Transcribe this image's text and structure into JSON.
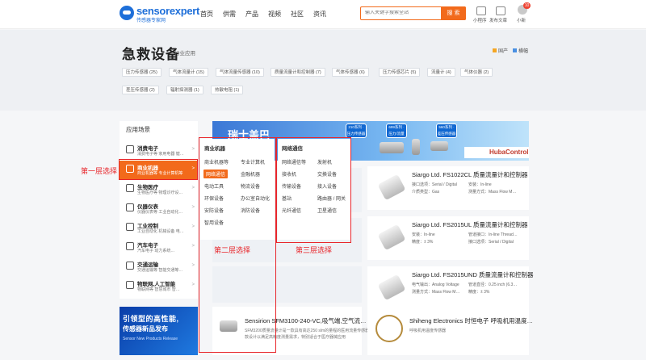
{
  "header": {
    "logo_text": "sensorexpert",
    "logo_sub": "传感器专家网",
    "nav": [
      "首页",
      "供需",
      "产品",
      "视频",
      "社区",
      "资讯"
    ],
    "search_placeholder": "输入关键字搜索全站",
    "search_button": "搜 索",
    "icons": [
      {
        "label": "小程序",
        "icon": "mini-program-icon"
      },
      {
        "label": "发布文章",
        "icon": "publish-icon"
      },
      {
        "label": "小新",
        "icon": "user-avatar-icon"
      }
    ],
    "badge": "10"
  },
  "title": {
    "main": "急救设备",
    "sub": "行业应用",
    "legend": [
      {
        "label": "国产",
        "color": "#f5a623"
      },
      {
        "label": "横幅",
        "color": "#4a90e2"
      }
    ]
  },
  "tags_row1": [
    "压力传感器 (25)",
    "气体流量计 (15)",
    "气体流量传感器 (10)",
    "质量流量计和控制器 (7)",
    "气体传感器 (6)",
    "压力传感芯片 (5)",
    "流量计 (4)",
    "气体仪器 (2)"
  ],
  "tags_row2": [
    "差压传感器 (2)",
    "辐射探测器 (1)",
    "热敏电阻 (1)"
  ],
  "sidebar": {
    "heading": "应用场景",
    "items": [
      {
        "title": "消费电子",
        "sub": "消费电子等  家用电器  健…"
      },
      {
        "title": "商业机器",
        "sub": "商业机器等  专业计算机等"
      },
      {
        "title": "生物医疗",
        "sub": "生物医疗等  物理诊疗设…"
      },
      {
        "title": "仪器仪表",
        "sub": "仪器仪表等  工业自动化…"
      },
      {
        "title": "工业控制",
        "sub": "工业自动化  机械设备  电…"
      },
      {
        "title": "汽车电子",
        "sub": "汽车电子   动力系统…"
      },
      {
        "title": "交通运输",
        "sub": "交通运输等  智能交通等…"
      },
      {
        "title": "物联网,人工智能",
        "sub": "物联网等  智慧城市  智…"
      }
    ]
  },
  "menu2": {
    "heading": "商业机器",
    "items": [
      "商业机器等",
      "专业计算机",
      "网络通信",
      "金融机器",
      "电动工具",
      "物流设备",
      "环保设备",
      "办公室自动化",
      "安防设备",
      "消防设备",
      "智用设备"
    ]
  },
  "menu3": {
    "heading": "网络通信",
    "items": [
      "网络通信等",
      "发射机",
      "接收机",
      "交换设备",
      "传输设备",
      "接入设备",
      "基站",
      "路由器 / 网关",
      "光纤通信",
      "卫星通信"
    ]
  },
  "annotations": {
    "first": "第一层选择",
    "second": "第二层选择",
    "third": "第三层选择"
  },
  "ad": {
    "line1": "引领型的高性能,",
    "line2": "传感器新品发布",
    "line3": "Sensor New Products Release"
  },
  "banner": {
    "title": "瑞士盖巴",
    "brand": "HubaControl",
    "badges": [
      "210系列 · 压力传感器",
      "699系列 · 压力/流量",
      "560系列 · 差压传感器"
    ]
  },
  "products": [
    {
      "title": "Siargo Ltd. FS1022CL 质量流量计和控制器",
      "specs": [
        "接口选项：Serial / Digital",
        "安装：In-line",
        "介质类型：Gas",
        "测量方式：Mass Flow M…"
      ]
    },
    {
      "title": "Siargo Ltd. FS2015UL 质量流量计和控制器",
      "specs": [
        "安装：In-line",
        "管道接口：In-line Thread…",
        "精度：± 3%",
        "接口选项：Serial / Digital"
      ]
    },
    {
      "title": "Siargo Ltd. FS2015UND 质量流量计和控制器",
      "specs": [
        "电气输出：Analog Voltage",
        "管道直径：0.25 inch (6.3…",
        "测量方式：Mass Flow M…",
        "精度：± 3%"
      ]
    }
  ],
  "bottom": [
    {
      "title": "Sensirion SFM3100-240-VC,吸气端,空气流…",
      "desc": "SFM3200质量流量计是一款具有高达250 slm的量程的医用流量传感器，本",
      "desc2": "款设计以满足高精度测量需求，特别适合于医疗器械应用"
    },
    {
      "title": "Shiheng Electronics 时恒电子 呼吸机用温度…",
      "desc": "呼吸机用温度传感器",
      "desc2": ""
    }
  ]
}
